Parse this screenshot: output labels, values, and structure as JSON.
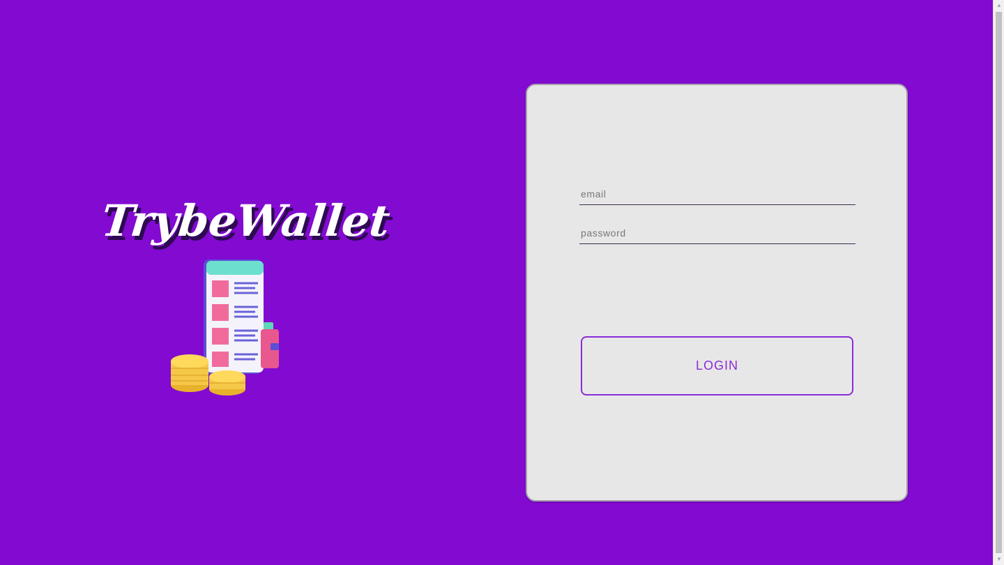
{
  "brand": {
    "logo_text": "TrybeWallet",
    "illustration": "wallet-phone-coins-illustration"
  },
  "login": {
    "email_placeholder": "email",
    "email_value": "",
    "password_placeholder": "password",
    "password_value": "",
    "button_label": "LOGIN"
  },
  "colors": {
    "background": "#820ad1",
    "card": "#e8e7e8",
    "accent": "#8a2bd6"
  }
}
